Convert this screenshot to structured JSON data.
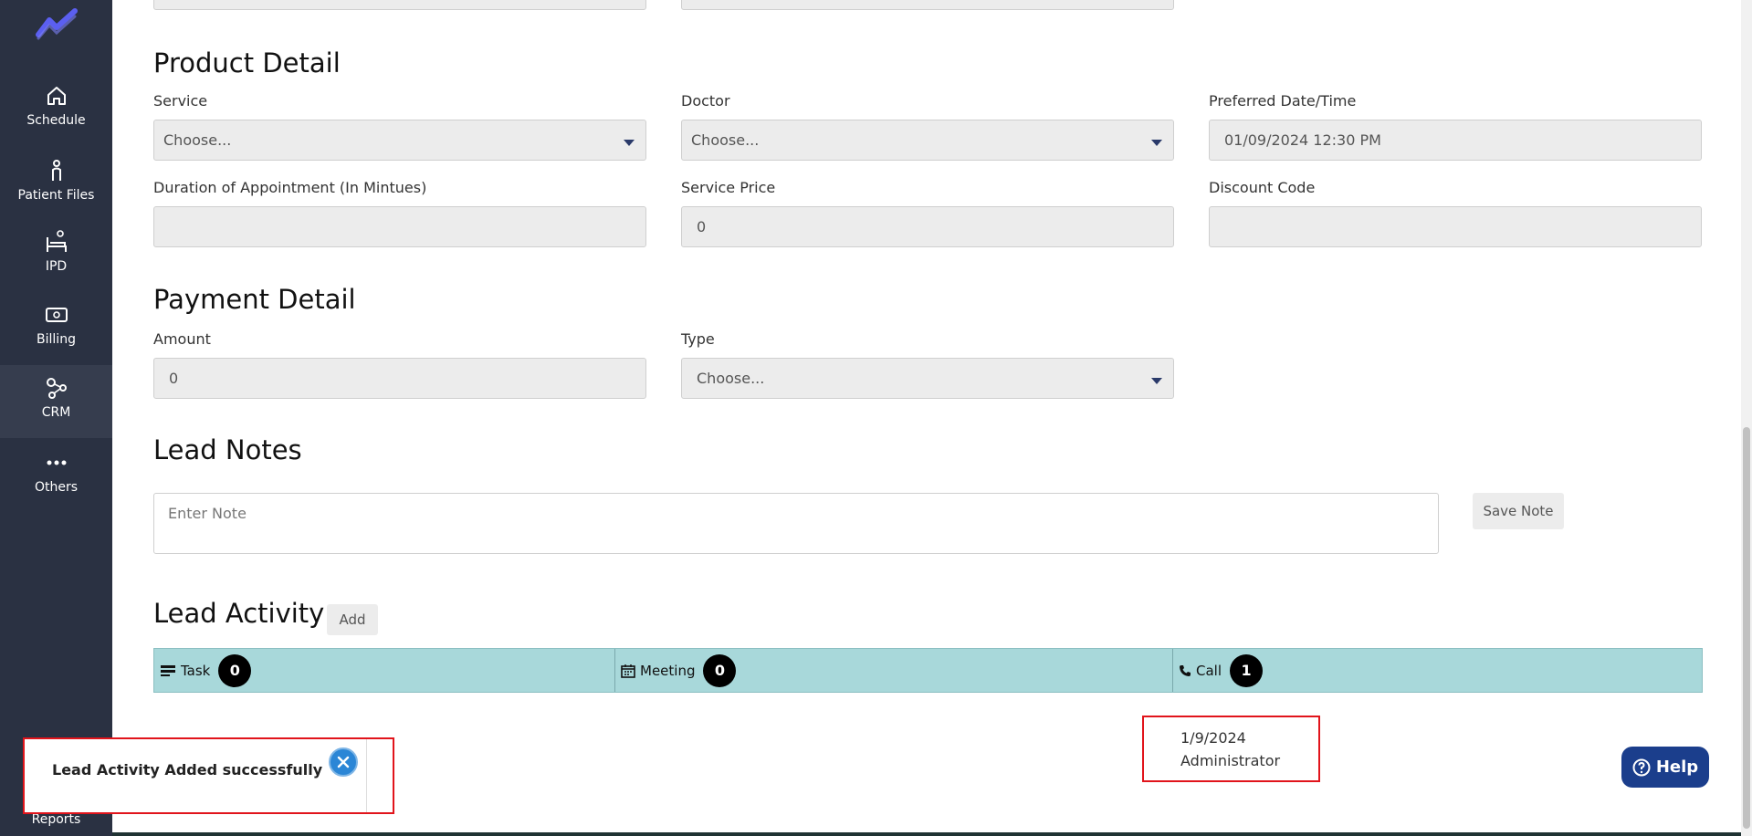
{
  "sidebar": {
    "items": [
      {
        "label": "Schedule"
      },
      {
        "label": "Patient Files"
      },
      {
        "label": "IPD"
      },
      {
        "label": "Billing"
      },
      {
        "label": "CRM"
      },
      {
        "label": "Others"
      }
    ],
    "reports_label": "Reports"
  },
  "product_detail": {
    "title": "Product Detail",
    "service_label": "Service",
    "service_value": "Choose...",
    "doctor_label": "Doctor",
    "doctor_value": "Choose...",
    "date_label": "Preferred Date/Time",
    "date_value": "01/09/2024 12:30 PM",
    "duration_label": "Duration of Appointment (In Mintues)",
    "duration_value": "",
    "price_label": "Service Price",
    "price_value": "0",
    "discount_label": "Discount Code",
    "discount_value": ""
  },
  "payment_detail": {
    "title": "Payment Detail",
    "amount_label": "Amount",
    "amount_value": "0",
    "type_label": "Type",
    "type_value": "Choose..."
  },
  "lead_notes": {
    "title": "Lead Notes",
    "placeholder": "Enter Note",
    "save_label": "Save Note"
  },
  "lead_activity": {
    "title": "Lead Activity",
    "add_label": "Add",
    "tabs": [
      {
        "label": "Task",
        "count": "0"
      },
      {
        "label": "Meeting",
        "count": "0"
      },
      {
        "label": "Call",
        "count": "1"
      }
    ],
    "entry": {
      "date": "1/9/2024",
      "user": "Administrator"
    }
  },
  "help": {
    "label": "Help"
  },
  "toast": {
    "message": "Lead Activity Added successfully"
  },
  "colors": {
    "sidebar": "#2a3142",
    "tab_bar": "#a8d8da",
    "help": "#1b3e8c",
    "highlight": "#e1141b"
  }
}
